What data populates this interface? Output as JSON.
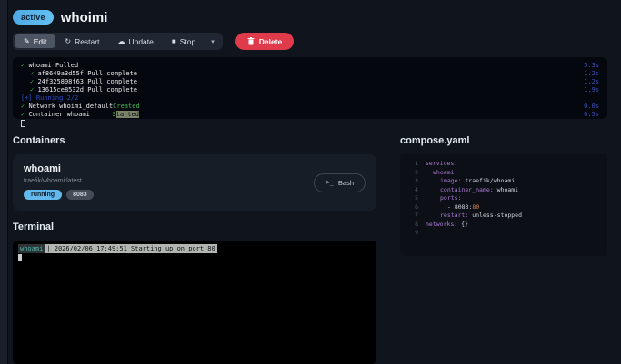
{
  "header": {
    "status_badge": "active",
    "title": "whoimi"
  },
  "toolbar": {
    "edit_label": "Edit",
    "restart_label": "Restart",
    "update_label": "Update",
    "stop_label": "Stop",
    "delete_label": "Delete"
  },
  "icons": {
    "edit": "✎",
    "restart": "↻",
    "update": "☁",
    "stop": "■",
    "caret": "▾",
    "bash": ">_",
    "check": "✓"
  },
  "log": {
    "lines": [
      {
        "check": "✓",
        "text": "whoami Pulled",
        "time": "5.3s"
      },
      {
        "check": "✓",
        "text": "af8649a3d55f Pull complete",
        "time": "1.2s"
      },
      {
        "check": "✓",
        "text": "24f325898f63 Pull complete",
        "time": "1.2s"
      },
      {
        "check": "✓",
        "text": "13615ce8532d Pull complete",
        "time": "1.9s"
      },
      {
        "text": "[+] Running 2/2"
      },
      {
        "check": "✓",
        "name": "Network whoimi_default",
        "status": "Created",
        "time": "0.0s"
      },
      {
        "check": "✓",
        "name": "Container whoami",
        "status_first": "S",
        "status_rest": "tarted",
        "time": "0.5s"
      }
    ]
  },
  "containers": {
    "heading": "Containers",
    "card": {
      "name": "whoami",
      "image": "traefik/whoami:latest",
      "status_badge": "running",
      "port_badge": "8083",
      "bash_label": "Bash"
    }
  },
  "terminal": {
    "heading": "Terminal",
    "prompt": "whoami",
    "message": "| 2026/02/06 17:49:51 Starting up on port 80"
  },
  "compose": {
    "heading": "compose.yaml",
    "lines": [
      {
        "num": "1",
        "key": "services:"
      },
      {
        "num": "2",
        "key": "whoami:"
      },
      {
        "num": "3",
        "key": "image:",
        "value": " traefik/whoami"
      },
      {
        "num": "4",
        "key": "container_name:",
        "value": " whoami"
      },
      {
        "num": "5",
        "key": "ports:"
      },
      {
        "num": "6",
        "plain": "- 8083:",
        "port": "80"
      },
      {
        "num": "7",
        "key": "restart:",
        "value": " unless-stopped"
      },
      {
        "num": "8",
        "key": "networks:",
        "value": " {}"
      },
      {
        "num": "9"
      }
    ]
  },
  "colors": {
    "accent_blue": "#64b9ec",
    "delete_red": "#e03b4b",
    "success_green": "#3fb950",
    "time_blue": "#3c4fc0",
    "yaml_key_purple": "#b07cd6",
    "yaml_number_orange": "#d1864a",
    "terminal_prompt_teal": "#4fb6a8"
  }
}
